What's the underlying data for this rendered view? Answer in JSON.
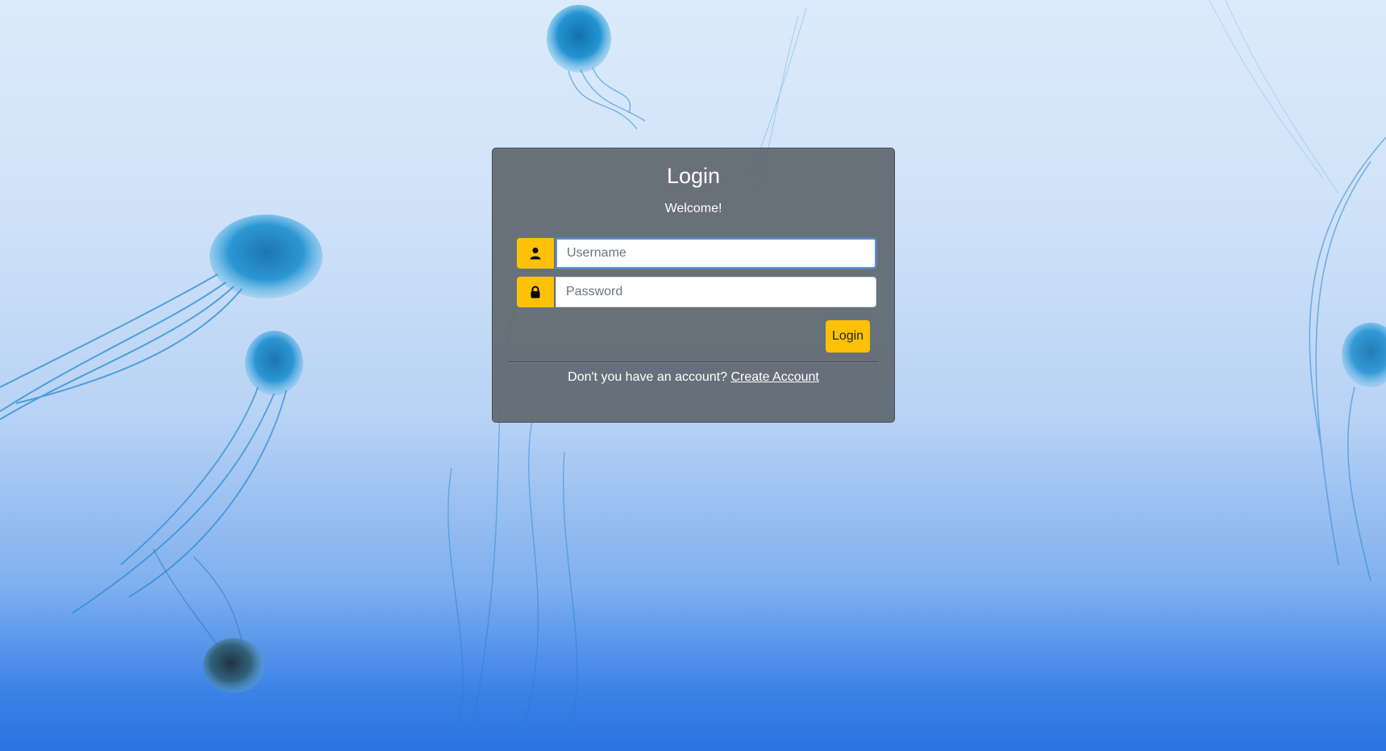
{
  "login_card": {
    "title": "Login",
    "subtitle": "Welcome!",
    "username": {
      "value": "",
      "placeholder": "Username",
      "icon": "user-icon"
    },
    "password": {
      "value": "",
      "placeholder": "Password",
      "icon": "lock-icon"
    },
    "submit_label": "Login",
    "footer_text": "Don't you have an account?",
    "footer_link": "Create Account"
  },
  "colors": {
    "accent": "#ffc107",
    "card_background": "#606870",
    "text": "#ffffff",
    "focus_border": "#5b8fd6"
  }
}
